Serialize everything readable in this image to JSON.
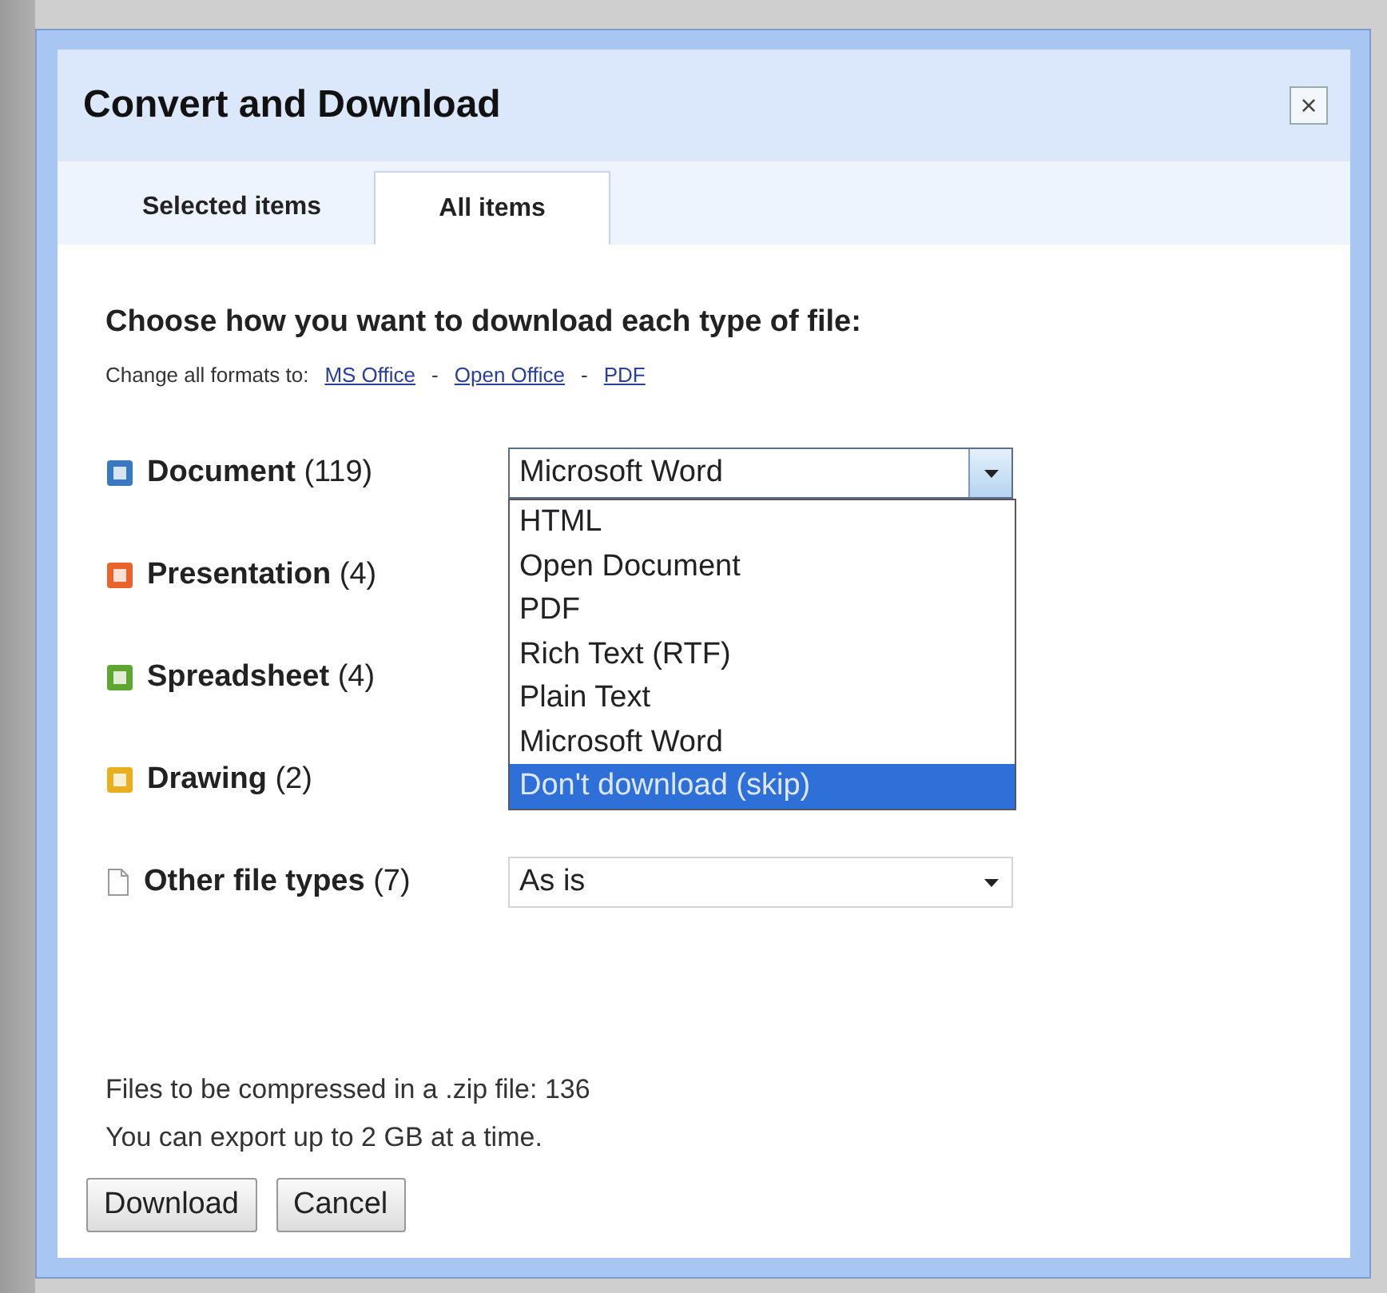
{
  "dialog": {
    "title": "Convert and Download",
    "close": "×"
  },
  "tabs": [
    {
      "label": "Selected items",
      "selected": false
    },
    {
      "label": "All items",
      "selected": true
    }
  ],
  "heading": "Choose how you want to download each type of file:",
  "change_all": {
    "label": "Change all formats to:",
    "links": [
      "MS Office",
      "Open Office",
      "PDF"
    ],
    "separator": "-"
  },
  "rows": [
    {
      "kind": "select",
      "name": "Document",
      "count": "(119)",
      "color": "#3a78c0",
      "value": "Microsoft Word",
      "open": true,
      "options": [
        {
          "label": "HTML",
          "highlighted": false
        },
        {
          "label": "Open Document",
          "highlighted": false
        },
        {
          "label": "PDF",
          "highlighted": false
        },
        {
          "label": "Rich Text (RTF)",
          "highlighted": false
        },
        {
          "label": "Plain Text",
          "highlighted": false
        },
        {
          "label": "Microsoft Word",
          "highlighted": false
        },
        {
          "label": "Don't download (skip)",
          "highlighted": true
        }
      ]
    },
    {
      "kind": "covered",
      "name": "Presentation",
      "count": "(4)",
      "color": "#e8642a"
    },
    {
      "kind": "covered",
      "name": "Spreadsheet",
      "count": "(4)",
      "color": "#5fa631"
    },
    {
      "kind": "covered",
      "name": "Drawing",
      "count": "(2)",
      "color": "#e8b020"
    },
    {
      "kind": "select",
      "name": "Other file types",
      "count": "(7)",
      "value": "As is",
      "open": false
    }
  ],
  "footer": [
    "Files to be compressed in a .zip file: 136",
    "You can export up to 2 GB at a time."
  ],
  "buttons": [
    "Download",
    "Cancel"
  ]
}
